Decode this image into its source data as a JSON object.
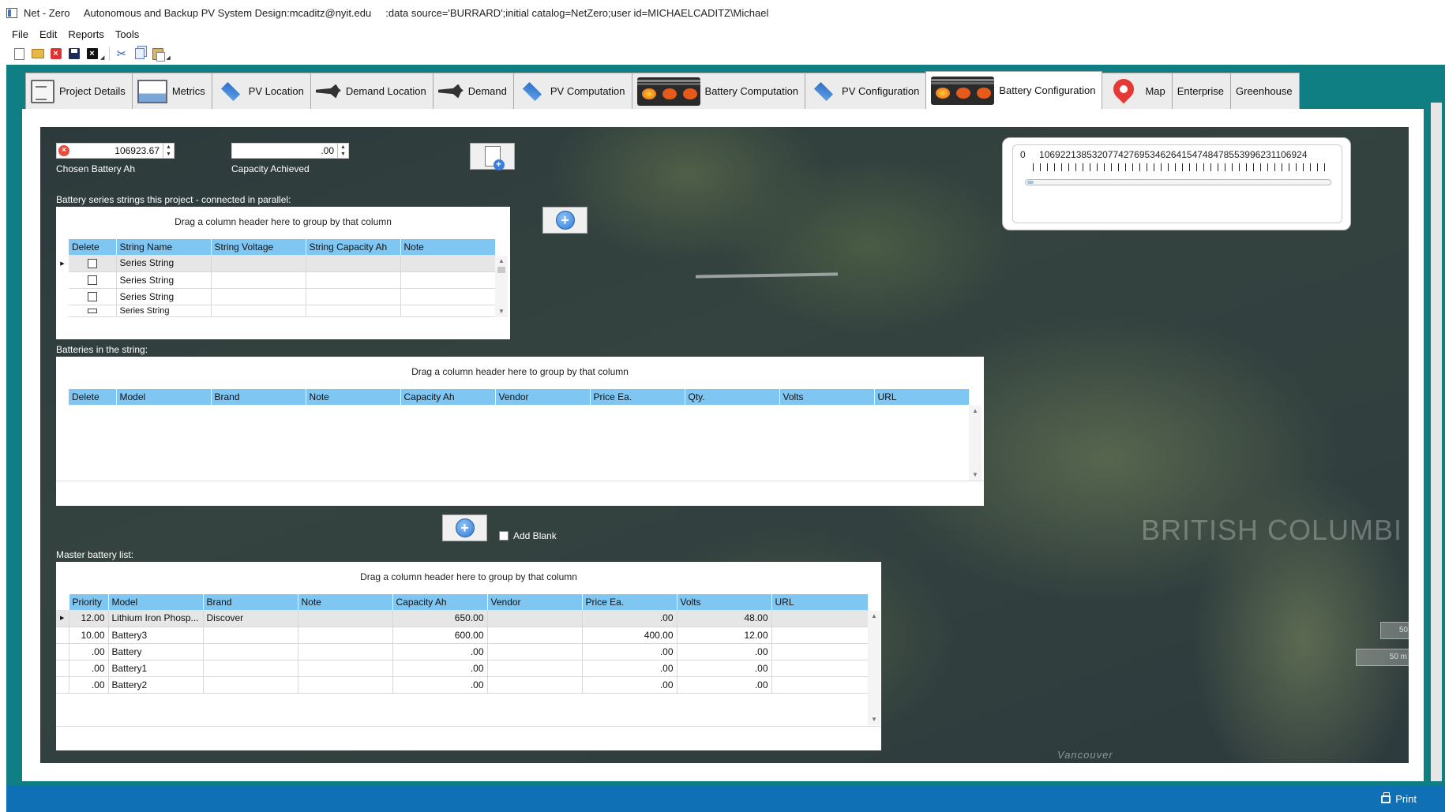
{
  "window": {
    "title": "Net - Zero     Autonomous and Backup PV System Design:mcaditz@nyit.edu     :data source='BURRARD';initial catalog=NetZero;user id=MICHAELCADITZ\\Michael"
  },
  "menu": {
    "file": "File",
    "edit": "Edit",
    "reports": "Reports",
    "tools": "Tools"
  },
  "tabs": {
    "project_details": "Project Details",
    "metrics": "Metrics",
    "pv_location": "PV Location",
    "demand_location": "Demand Location",
    "demand": "Demand",
    "pv_computation": "PV Computation",
    "battery_computation": "Battery Computation",
    "pv_configuration": "PV Configuration",
    "battery_configuration": "Battery Configuration",
    "map": "Map",
    "enterprise": "Enterprise",
    "greenhouse": "Greenhouse",
    "active": "Battery Configuration"
  },
  "fields": {
    "chosen_battery_ah_value": "106923.67",
    "chosen_battery_ah_label": "Chosen Battery Ah",
    "capacity_achieved_value": ".00",
    "capacity_achieved_label": "Capacity Achieved"
  },
  "slider": {
    "min": "0",
    "max_label": "1069221385320774276953462641547484785539962311069​24"
  },
  "strings_grid": {
    "caption": "Battery series strings this project - connected in parallel:",
    "group_hint": "Drag a column header here to group by that column",
    "columns": {
      "delete": "Delete",
      "name": "String Name",
      "voltage": "String Voltage",
      "capacity": "String Capacity Ah",
      "note": "Note"
    },
    "rows": [
      {
        "name": "Series String"
      },
      {
        "name": "Series String"
      },
      {
        "name": "Series String"
      },
      {
        "name": "Series String"
      }
    ]
  },
  "batteries_grid": {
    "caption": "Batteries in the string:",
    "group_hint": "Drag a column header here to group by that column",
    "columns": {
      "delete": "Delete",
      "model": "Model",
      "brand": "Brand",
      "note": "Note",
      "capacity": "Capacity Ah",
      "vendor": "Vendor",
      "price": "Price Ea.",
      "qty": "Qty.",
      "volts": "Volts",
      "url": "URL"
    }
  },
  "add_blank": {
    "label": "Add Blank"
  },
  "master_grid": {
    "caption": "Master battery list:",
    "group_hint": "Drag a column header here to group by that column",
    "columns": {
      "priority": "Priority",
      "model": "Model",
      "brand": "Brand",
      "note": "Note",
      "capacity": "Capacity Ah",
      "vendor": "Vendor",
      "price": "Price Ea.",
      "volts": "Volts",
      "url": "URL"
    },
    "rows": [
      {
        "priority": "12.00",
        "model": "Lithium Iron Phosp...",
        "brand": "Discover",
        "note": "",
        "capacity": "650.00",
        "vendor": "",
        "price": ".00",
        "volts": "48.00",
        "url": ""
      },
      {
        "priority": "10.00",
        "model": "Battery3",
        "brand": "",
        "note": "",
        "capacity": "600.00",
        "vendor": "",
        "price": "400.00",
        "volts": "12.00",
        "url": ""
      },
      {
        "priority": ".00",
        "model": "Battery",
        "brand": "",
        "note": "",
        "capacity": ".00",
        "vendor": "",
        "price": ".00",
        "volts": ".00",
        "url": ""
      },
      {
        "priority": ".00",
        "model": "Battery1",
        "brand": "",
        "note": "",
        "capacity": ".00",
        "vendor": "",
        "price": ".00",
        "volts": ".00",
        "url": ""
      },
      {
        "priority": ".00",
        "model": "Battery2",
        "brand": "",
        "note": "",
        "capacity": ".00",
        "vendor": "",
        "price": ".00",
        "volts": ".00",
        "url": ""
      }
    ]
  },
  "map": {
    "region_label": "BRITISH COLUMBI",
    "city_label": "Vancouver",
    "scale_1": "50",
    "scale_2": "50 m"
  },
  "status": {
    "print_label": "Print"
  }
}
